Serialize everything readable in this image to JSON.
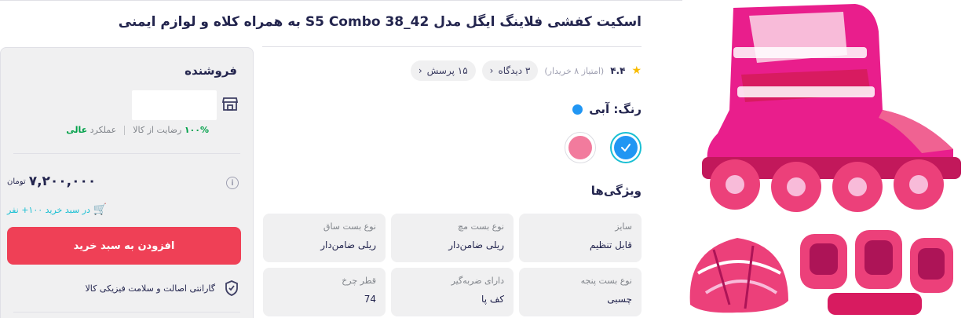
{
  "product": {
    "title": "اسکیت کفشی فلاینگ ایگل مدل S5 Combo 38_42 به همراه کلاه و لوازم ایمنی",
    "rating": "۴.۴",
    "rating_sub": "(امتیاز ۸ خریدار)",
    "pills": [
      {
        "label": "۳ دیدگاه"
      },
      {
        "label": "۱۵ پرسش"
      }
    ],
    "color_label": "رنگ: آبی",
    "swatch_colors": [
      "#2196f3",
      "#f27b9d"
    ],
    "features_title": "ویژگی‌ها",
    "specs": [
      {
        "key": "سایز",
        "value": "قابل تنظیم"
      },
      {
        "key": "نوع بست مچ",
        "value": "ریلی ضامن‌دار"
      },
      {
        "key": "نوع بست ساق",
        "value": "ریلی ضامن‌دار"
      },
      {
        "key": "نوع بست پنجه",
        "value": "چسبی"
      },
      {
        "key": "دارای ضربه‌گیر",
        "value": "کف پا"
      },
      {
        "key": "قطر چرخ",
        "value": "74"
      }
    ]
  },
  "seller": {
    "title": "فروشنده",
    "satisfaction_value": "۱۰۰%",
    "satisfaction_text": "رضایت از کالا",
    "performance_label": "عملکرد",
    "performance_value": "عالی",
    "price": "۷,۲۰۰,۰۰۰",
    "currency": "تومان",
    "cart_note": "در سبد خرید ۱۰۰+ نفر",
    "add_to_cart": "افزودن به سبد خرید",
    "guarantee": "گارانتی اصالت و سلامت فیزیکی کالا"
  },
  "colors": {
    "accent_red": "#ef4056",
    "accent_teal": "#19bfd3",
    "success_green": "#00a049",
    "star": "#f9bc00"
  },
  "icons": {
    "star": "star-icon",
    "shop": "shop-icon",
    "info": "info-icon",
    "cart": "cart-icon",
    "shield": "shield-icon",
    "check": "check-icon",
    "chevron": "chevron-left-icon"
  }
}
